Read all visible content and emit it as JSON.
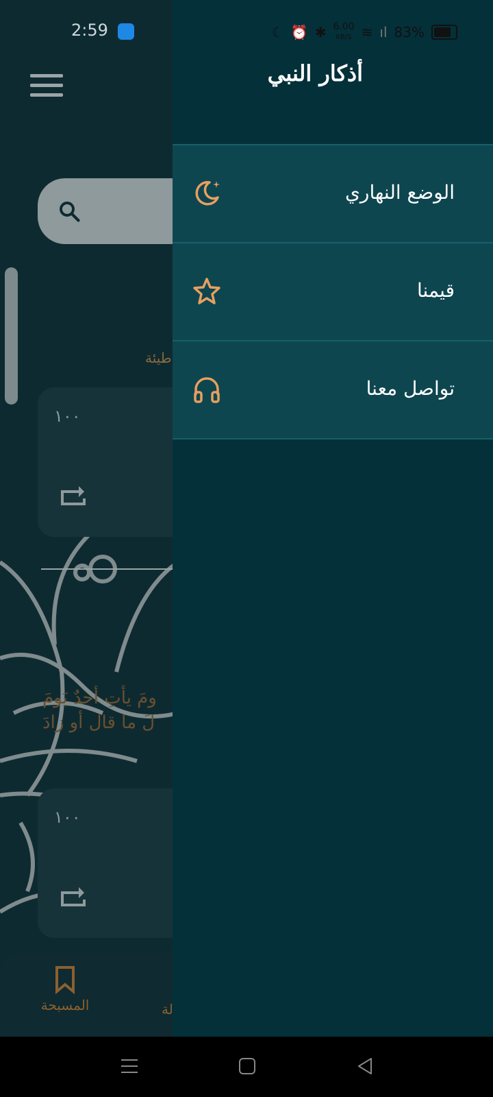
{
  "status_bar": {
    "time": "2:59",
    "network_speed": "6.00",
    "network_unit": "KB/S",
    "battery": "83%"
  },
  "app": {
    "category_partial": "طيئة",
    "card1_count": "١٠٠",
    "card2_count": "١٠٠",
    "verse_line1": "ومَ يأتِ أحدٌ يَومَ",
    "verse_line2": "لَ ما قال أو زادَ",
    "nav_tasbeeh": "المسبحة",
    "nav_other_partial": "لة"
  },
  "drawer": {
    "title": "أذكار النبي",
    "items": [
      {
        "label": "الوضع النهاري",
        "icon": "moon-stars-icon"
      },
      {
        "label": "قيمنا",
        "icon": "star-icon"
      },
      {
        "label": "تواصل معنا",
        "icon": "headphones-icon"
      }
    ]
  },
  "colors": {
    "drawer_bg": "#043039",
    "drawer_item_bg": "#0e4650",
    "accent": "#e8a060"
  }
}
